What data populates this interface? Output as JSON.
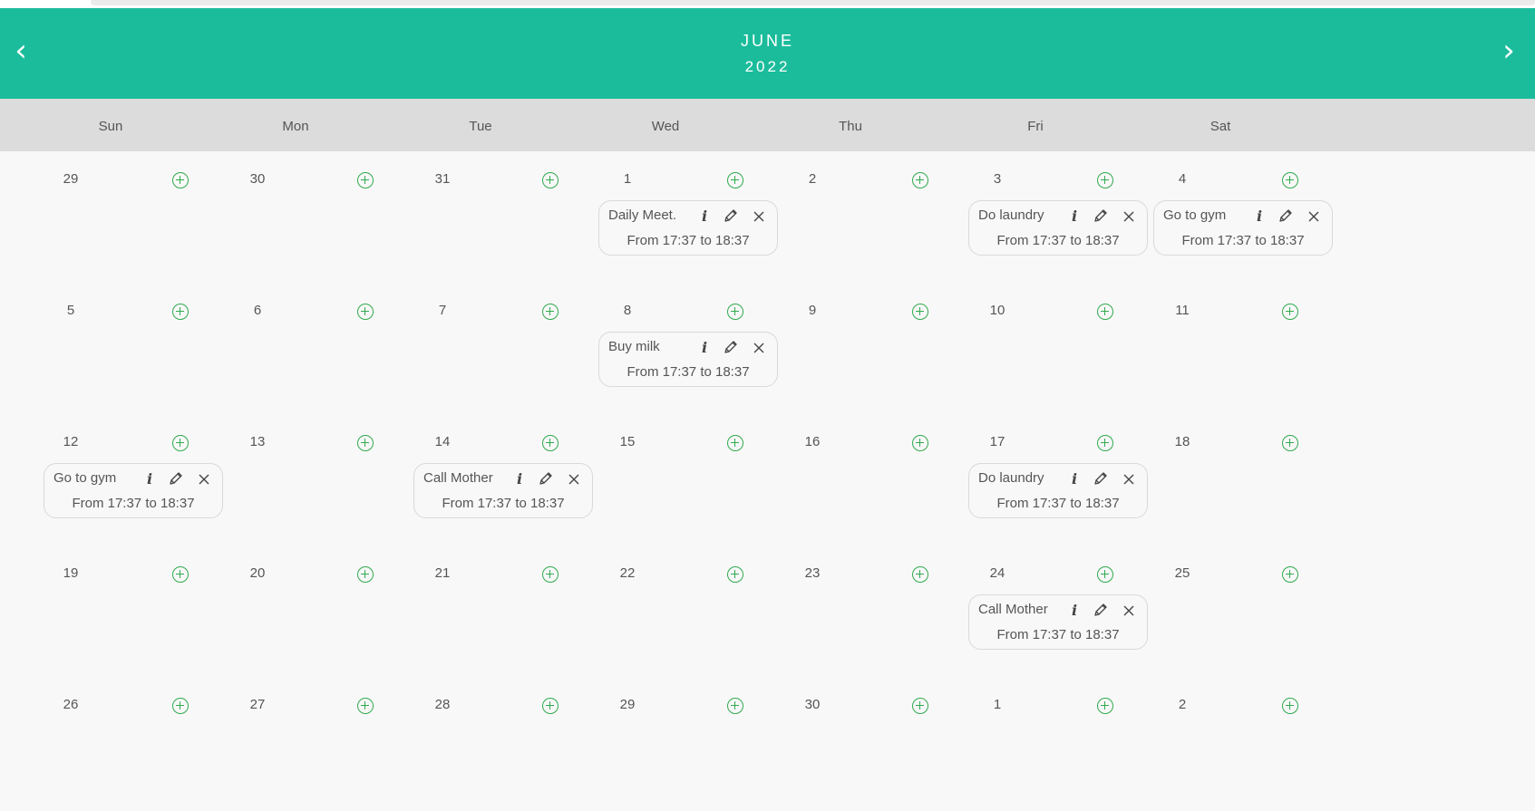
{
  "header": {
    "prev": "‹",
    "next": "›",
    "month": "JUNE",
    "year": "2022"
  },
  "weekdays": [
    "Sun",
    "Mon",
    "Tue",
    "Wed",
    "Thu",
    "Fri",
    "Sat"
  ],
  "weeks": [
    [
      {
        "day": "29",
        "events": []
      },
      {
        "day": "30",
        "events": []
      },
      {
        "day": "31",
        "events": []
      },
      {
        "day": "1",
        "events": [
          {
            "title": "Daily Meet.",
            "time": "From 17:37 to 18:37"
          }
        ]
      },
      {
        "day": "2",
        "events": []
      },
      {
        "day": "3",
        "events": [
          {
            "title": "Do laundry",
            "time": "From 17:37 to 18:37"
          }
        ]
      },
      {
        "day": "4",
        "events": [
          {
            "title": "Go to gym",
            "time": "From 17:37 to 18:37"
          }
        ]
      }
    ],
    [
      {
        "day": "5",
        "events": []
      },
      {
        "day": "6",
        "events": []
      },
      {
        "day": "7",
        "events": []
      },
      {
        "day": "8",
        "events": [
          {
            "title": "Buy milk",
            "time": "From 17:37 to 18:37"
          }
        ]
      },
      {
        "day": "9",
        "events": []
      },
      {
        "day": "10",
        "events": []
      },
      {
        "day": "11",
        "events": []
      }
    ],
    [
      {
        "day": "12",
        "events": [
          {
            "title": "Go to gym",
            "time": "From 17:37 to 18:37"
          }
        ]
      },
      {
        "day": "13",
        "events": []
      },
      {
        "day": "14",
        "events": [
          {
            "title": "Call Mother",
            "time": "From 17:37 to 18:37"
          }
        ]
      },
      {
        "day": "15",
        "events": []
      },
      {
        "day": "16",
        "events": []
      },
      {
        "day": "17",
        "events": [
          {
            "title": "Do laundry",
            "time": "From 17:37 to 18:37"
          }
        ]
      },
      {
        "day": "18",
        "events": []
      }
    ],
    [
      {
        "day": "19",
        "events": []
      },
      {
        "day": "20",
        "events": []
      },
      {
        "day": "21",
        "events": []
      },
      {
        "day": "22",
        "events": []
      },
      {
        "day": "23",
        "events": []
      },
      {
        "day": "24",
        "events": [
          {
            "title": "Call Mother",
            "time": "From 17:37 to 18:37"
          }
        ]
      },
      {
        "day": "25",
        "events": []
      }
    ],
    [
      {
        "day": "26",
        "events": []
      },
      {
        "day": "27",
        "events": []
      },
      {
        "day": "28",
        "events": []
      },
      {
        "day": "29",
        "events": []
      },
      {
        "day": "30",
        "events": []
      },
      {
        "day": "1",
        "events": []
      },
      {
        "day": "2",
        "events": []
      }
    ]
  ],
  "icons": {
    "add": "plus-circle-icon",
    "info": "info-icon",
    "edit": "pencil-icon",
    "delete": "close-icon"
  },
  "event_info_glyph": "i",
  "colors": {
    "header": "#1bbc9b",
    "weekbar": "#dcdcdc",
    "background": "#f9f8f8",
    "add_icon": "#2faa4e"
  }
}
